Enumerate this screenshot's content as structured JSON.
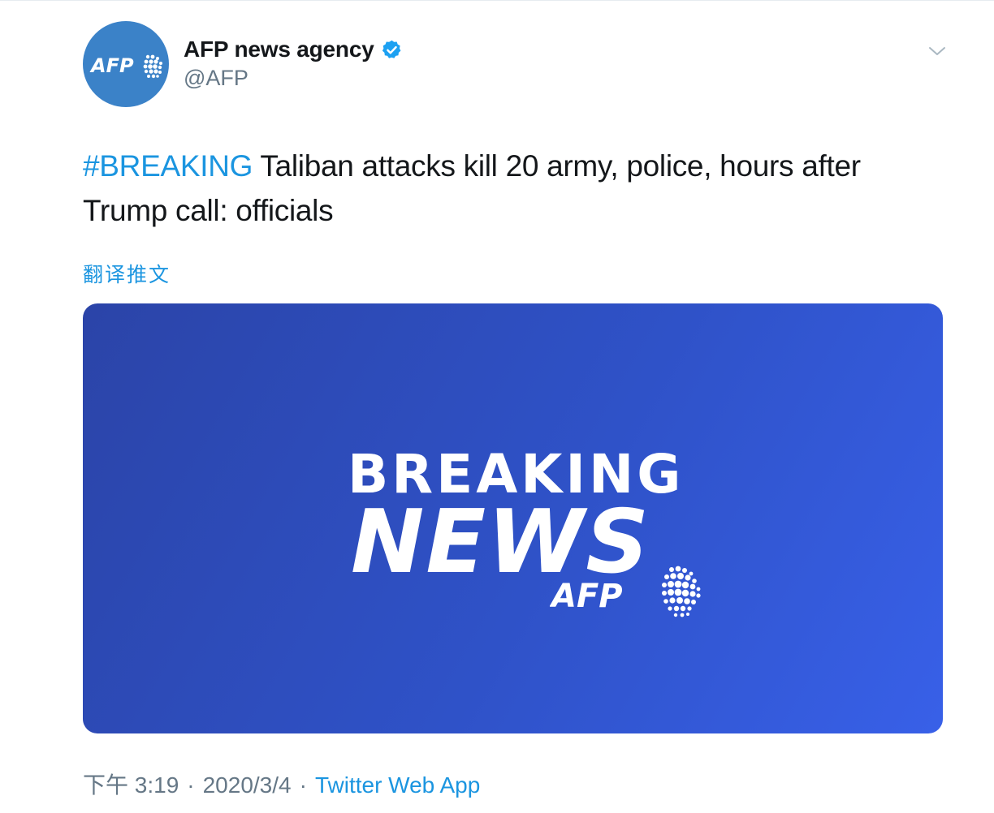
{
  "author": {
    "display_name": "AFP news agency",
    "handle": "@AFP",
    "avatar_logo_text": "AFP",
    "verified_icon": "verified-badge-icon"
  },
  "tweet": {
    "hashtag": "#BREAKING",
    "text": " Taliban attacks kill 20 army, police, hours after Trump call: officials",
    "translate_label": "翻译推文"
  },
  "media": {
    "line1": "BREAKING",
    "line2": "NEWS",
    "logo_text": "AFP"
  },
  "meta": {
    "time": "下午 3:19",
    "separator": "·",
    "date": "2020/3/4",
    "source": "Twitter Web App"
  },
  "colors": {
    "link": "#1b95e0",
    "text": "#14171a",
    "muted": "#657786",
    "avatar_bg": "#3b82c8",
    "media_bg": "#2f52c8"
  }
}
